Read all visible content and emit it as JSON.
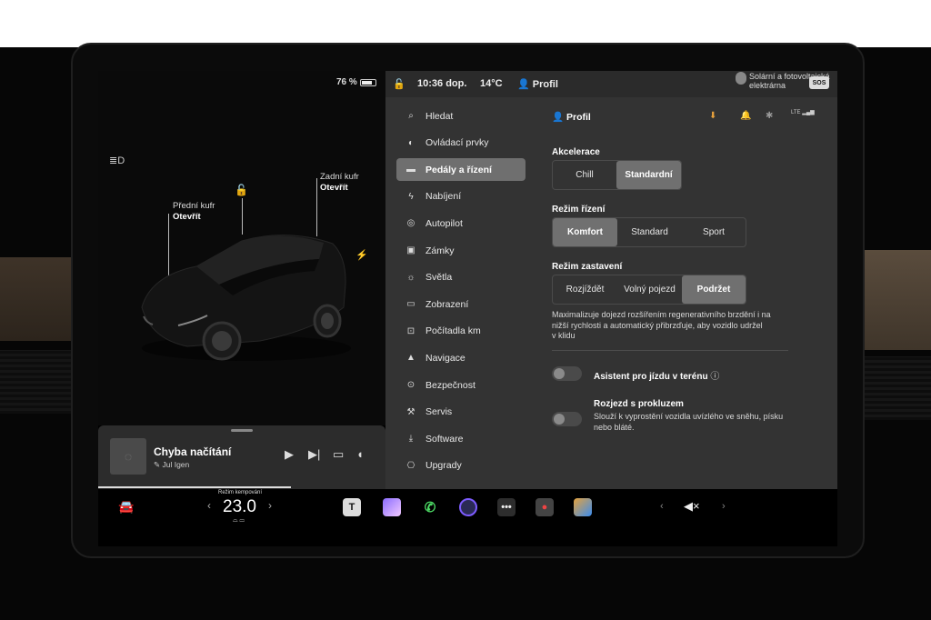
{
  "car": {
    "battery_percent": "76 %",
    "battery_level": 0.76,
    "front_trunk_label": "Přední kufr",
    "front_trunk_state": "Otevřít",
    "rear_trunk_label": "Zadní kufr",
    "rear_trunk_state": "Otevřít"
  },
  "media": {
    "title": "Chyba načítání",
    "artist": "Jul Igen"
  },
  "status": {
    "time": "10:36 dop.",
    "temperature": "14°C",
    "profile": "Profil",
    "charger_line1": "Solární a fotovoltaická",
    "charger_line2": "elektrárna",
    "sos": "SOS",
    "lte": "LTE"
  },
  "nav": [
    {
      "label": "Hledat",
      "icon": "search-icon"
    },
    {
      "label": "Ovládací prvky",
      "icon": "toggle-icon"
    },
    {
      "label": "Pedály a řízení",
      "icon": "car-icon",
      "active": true
    },
    {
      "label": "Nabíjení",
      "icon": "bolt-icon"
    },
    {
      "label": "Autopilot",
      "icon": "steering-wheel-icon"
    },
    {
      "label": "Zámky",
      "icon": "lock-icon"
    },
    {
      "label": "Světla",
      "icon": "sun-icon"
    },
    {
      "label": "Zobrazení",
      "icon": "display-icon"
    },
    {
      "label": "Počítadla km",
      "icon": "trip-icon"
    },
    {
      "label": "Navigace",
      "icon": "navigation-icon"
    },
    {
      "label": "Bezpečnost",
      "icon": "shield-icon"
    },
    {
      "label": "Servis",
      "icon": "wrench-icon"
    },
    {
      "label": "Software",
      "icon": "download-icon"
    },
    {
      "label": "Upgrady",
      "icon": "bag-icon"
    }
  ],
  "settings": {
    "profile": "Profil",
    "acceleration": {
      "title": "Akcelerace",
      "options": [
        "Chill",
        "Standardní"
      ],
      "selected": "Standardní"
    },
    "steering": {
      "title": "Režim řízení",
      "options": [
        "Komfort",
        "Standard",
        "Sport"
      ],
      "selected": "Komfort"
    },
    "stopping": {
      "title": "Režim zastavení",
      "options": [
        "Rozjíždět",
        "Volný pojezd",
        "Podržet"
      ],
      "selected": "Podržet"
    },
    "stopping_desc_1": "Maximalizuje dojezd rozšířením regenerativního brzdění i na",
    "stopping_desc_2": "nižší rychlosti a automatický přibrzďuje, aby vozidlo udržel",
    "stopping_desc_3": "v klidu",
    "offroad": {
      "title": "Asistent pro jízdu v terénu",
      "enabled": false
    },
    "slip": {
      "title": "Rozjezd s prokluzem",
      "desc_1": "Slouží k vyprostění vozidla uvízlého ve sněhu, písku",
      "desc_2": "nebo bláté.",
      "enabled": false
    }
  },
  "dock": {
    "climate_label": "Režim kempování",
    "temperature": "23.0",
    "volume_icon": "volume-muted-icon"
  }
}
